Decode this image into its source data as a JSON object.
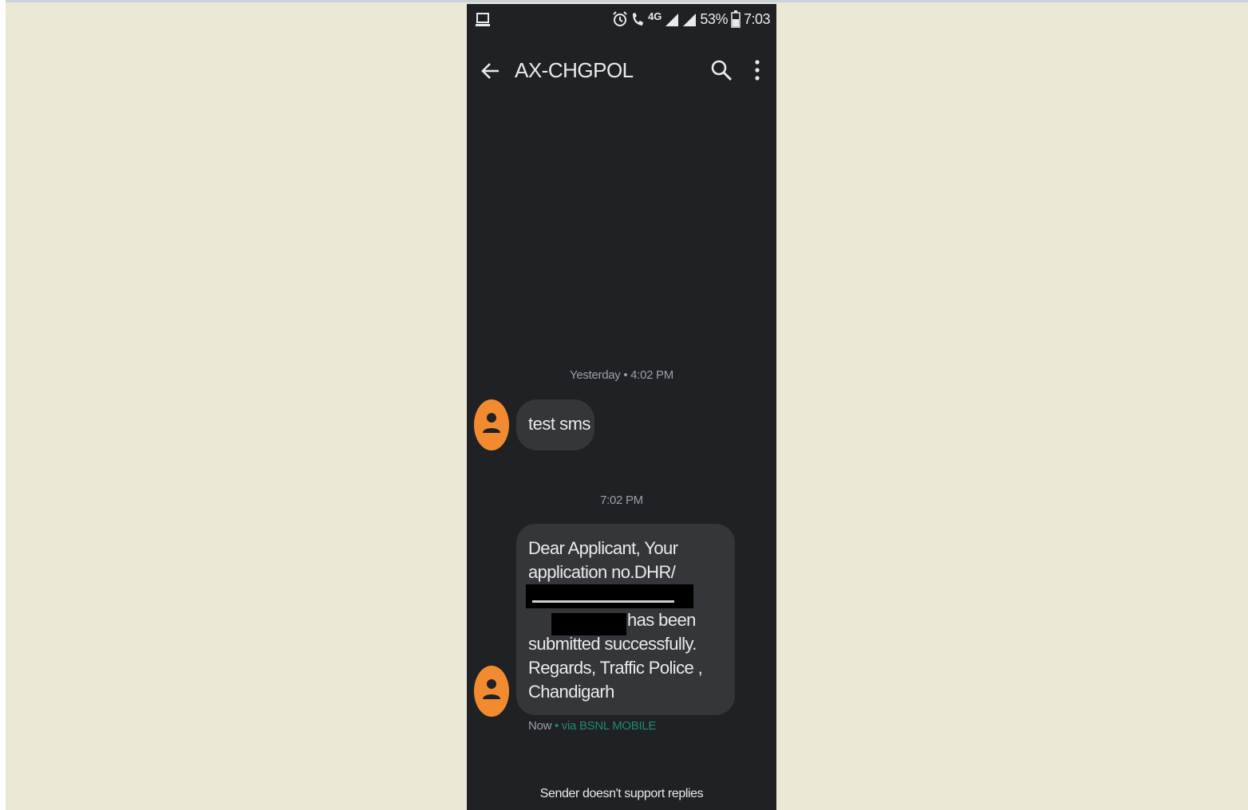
{
  "status_bar": {
    "network": "4G",
    "battery": "53%",
    "time": "7:03"
  },
  "app_bar": {
    "title": "AX-CHGPOL"
  },
  "conversation": {
    "group1": {
      "timestamp": "Yesterday • 4:02 PM",
      "message": "test sms"
    },
    "group2": {
      "timestamp": "7:02 PM",
      "lines": [
        "Dear Applicant, Your",
        "application no.DHR/",
        "has been",
        "submitted successfully.",
        "Regards, Traffic Police ,",
        "Chandigarh"
      ],
      "meta_time": "Now",
      "meta_via": " • via BSNL MOBILE"
    }
  },
  "footer": {
    "note": "Sender doesn't support replies"
  },
  "colors": {
    "background": "#ece8d6",
    "phone_background": "#202124",
    "bubble": "#35363a",
    "avatar": "#f28b30",
    "via_link": "#1f8a6e"
  },
  "icons": [
    "screen-mirror-icon",
    "alarm-icon",
    "call-icon",
    "signal-icon",
    "battery-icon",
    "back-arrow-icon",
    "search-icon",
    "more-vertical-icon",
    "contact-avatar-icon"
  ]
}
